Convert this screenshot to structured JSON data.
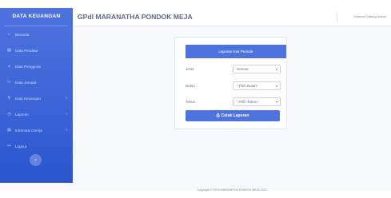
{
  "brand": "DATA KEUANGAN",
  "sidebar": {
    "items": [
      {
        "label": "Beranda",
        "icon": "home-icon"
      },
      {
        "label": "Data Pendeta",
        "icon": "user-icon"
      },
      {
        "label": "Data Pengguna",
        "icon": "users-icon"
      },
      {
        "label": "Data Jemaat",
        "icon": "group-icon"
      },
      {
        "label": "Data Keuangan",
        "icon": "wallet-icon",
        "chevron": true
      },
      {
        "label": "Laporan",
        "icon": "report-icon",
        "chevron": true
      },
      {
        "label": "Informasi Gereja",
        "icon": "info-icon",
        "chevron": true
      },
      {
        "label": "Logout",
        "icon": "logout-icon"
      }
    ]
  },
  "header": {
    "title": "GPdI MARANATHA PONDOK MEJA",
    "user": "Selamat Datang Admin"
  },
  "card": {
    "title": "Laporan Kas Periode",
    "fields": [
      {
        "label": "Jenis",
        "value": "Semua"
      },
      {
        "label": "Bulan",
        "value": "--Pilih Bulan--"
      },
      {
        "label": "Tahun",
        "value": "--Pilih Tahun--"
      }
    ],
    "button": "Cetak Laporan"
  },
  "footer": "Copyright © GPdI MARANATHA PONDOK MEJA 2022"
}
